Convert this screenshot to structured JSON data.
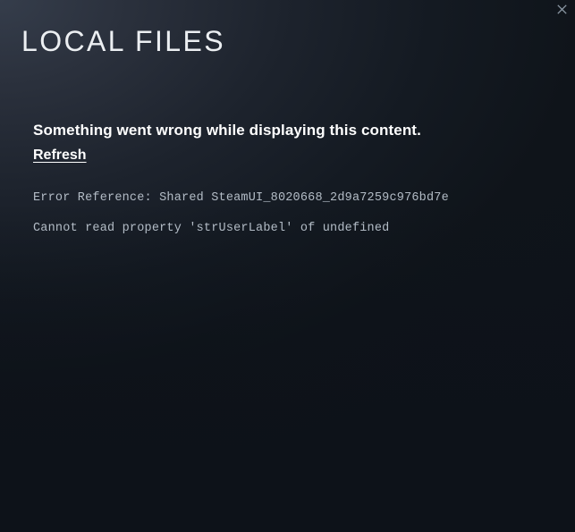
{
  "window": {
    "title": "LOCAL FILES",
    "background_top_left": "#2d3440",
    "background_bottom": "#0f141a"
  },
  "titlebar": {
    "close_label": "✕",
    "close_icon": "close-icon"
  },
  "error": {
    "headline": "Something went wrong while displaying this content.",
    "refresh_label": "Refresh",
    "reference_line": "Error Reference: Shared SteamUI_8020668_2d9a7259c976bd7e",
    "message_line": "Cannot read property 'strUserLabel' of undefined",
    "text_color": "#b3bcc6",
    "headline_color": "#ffffff"
  }
}
